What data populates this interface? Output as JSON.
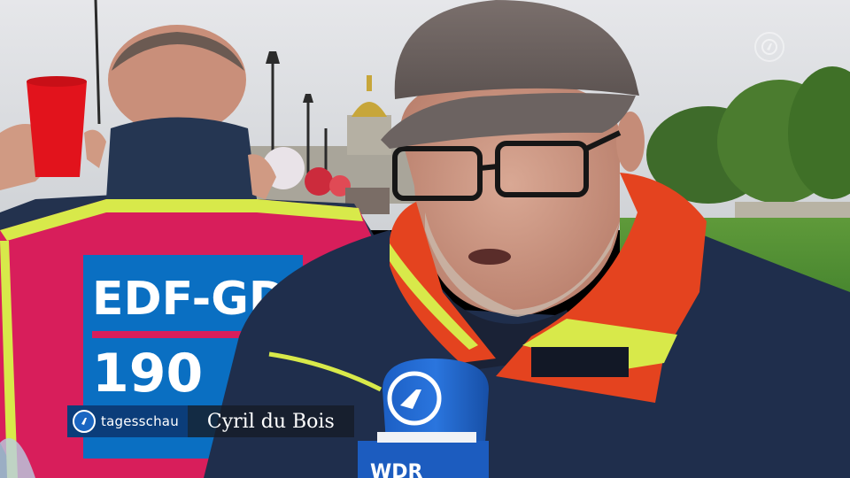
{
  "scene": {
    "vest_text_line1": "EDF-GDF",
    "vest_text_line2": "190",
    "mic_flag_text": "WDR",
    "channel_bug_icon": "das-erste-logo-icon"
  },
  "lower_third": {
    "brand_icon": "das-erste-logo-icon",
    "brand_label": "tagesschau",
    "person_name": "Cyril du Bois"
  },
  "colors": {
    "brand_blue": "#0b3d7a",
    "name_bar": "#161c28",
    "vest_pink": "#d81e5b",
    "jacket_navy": "#1f2e4c",
    "collar_orange": "#e4431f",
    "hi_vis_yellow": "#d8e94a"
  }
}
